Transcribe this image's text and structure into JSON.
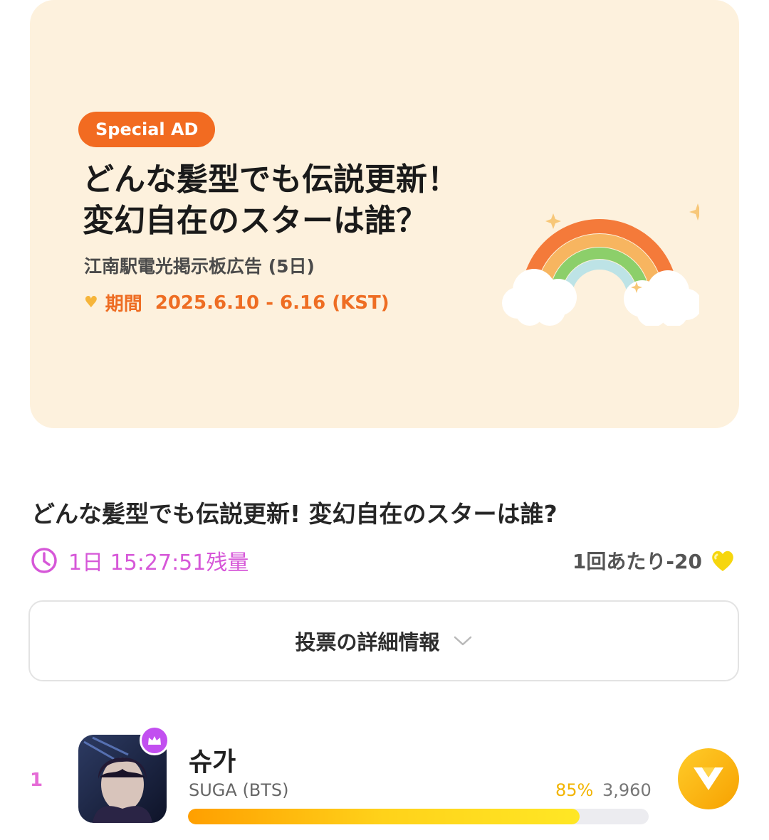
{
  "banner": {
    "badge": "Special AD",
    "title_line1": "どんな髪型でも伝説更新！",
    "title_line2": "変幻自在のスターは誰？",
    "subtitle": "江南駅電光掲示板広告 (5日)",
    "period_label": "期間",
    "period_dates": "2025.6.10  -  6.16 (KST)"
  },
  "poll": {
    "title": "どんな髪型でも伝説更新!  変幻自在のスターは誰?",
    "time_remaining": "1日 15:27:51残量",
    "cost": "1回あたり-20",
    "details_button": "投票の詳細情報"
  },
  "candidates": [
    {
      "rank": "1",
      "name": "슈가",
      "subname": "SUGA (BTS)",
      "percent_text": "85%",
      "percent": 85,
      "votes": "3,960"
    }
  ],
  "colors": {
    "accent_orange": "#f26b21",
    "timer_pink": "#d657d8",
    "gold": "#f2b400"
  }
}
